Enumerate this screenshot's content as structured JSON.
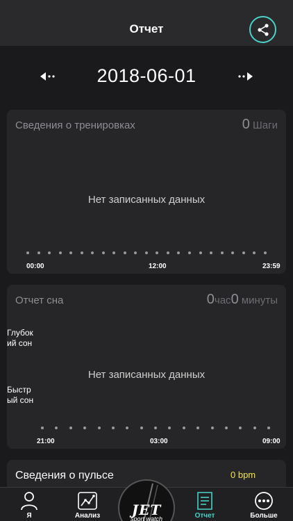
{
  "header": {
    "title": "Отчет",
    "share_icon": "share-icon"
  },
  "date_nav": {
    "date": "2018-06-01",
    "prev_icon": "prev-arrow-icon",
    "next_icon": "next-arrow-icon"
  },
  "training": {
    "title": "Сведения о тренировках",
    "value": "0",
    "unit": "Шаги",
    "empty": "Нет записанных данных",
    "time_labels": [
      "00:00",
      "12:00",
      "23:59"
    ]
  },
  "sleep": {
    "title": "Отчет сна",
    "hours_value": "0",
    "hours_unit": "час",
    "minutes_value": "0",
    "minutes_unit": "минуты",
    "empty": "Нет записанных данных",
    "deep_label": "Глубок ий сон",
    "fast_label": "Быстр ый сон",
    "time_labels": [
      "21:00",
      "03:00",
      "09:00"
    ]
  },
  "pulse": {
    "title": "Сведения о пульсе",
    "value": "0 bpm"
  },
  "tabs": [
    {
      "label": "Я",
      "icon": "person-icon"
    },
    {
      "label": "Анализ",
      "icon": "chart-icon"
    },
    {
      "label": "Отчет",
      "icon": "report-icon",
      "active": true
    },
    {
      "label": "Больше",
      "icon": "more-icon"
    }
  ],
  "logo": {
    "main": "JET",
    "sub": "sport watch"
  },
  "colors": {
    "accent": "#4ad2c8",
    "pulse": "#f5e44a",
    "background": "#1a1a1c",
    "card": "#262628"
  }
}
